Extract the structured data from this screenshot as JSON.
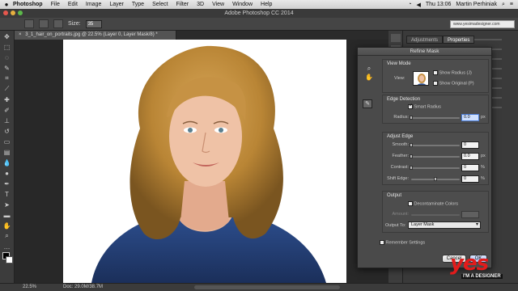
{
  "menubar": {
    "apple_icon": "apple-logo",
    "app_name": "Photoshop",
    "items": [
      "File",
      "Edit",
      "Image",
      "Layer",
      "Type",
      "Select",
      "Filter",
      "3D",
      "View",
      "Window",
      "Help"
    ],
    "clock": "Thu 13:06",
    "user": "Martin Perhiniak"
  },
  "window": {
    "title": "Adobe Photoshop CC 2014"
  },
  "options_bar": {
    "size_label": "Size:",
    "size_value": "35"
  },
  "url_box": "www.yesimadesigner.com",
  "document_tab": {
    "close": "×",
    "title": "3_1_hair_on_portraits.jpg @ 22.5% (Layer 0, Layer Mask/8) *"
  },
  "right_panel": {
    "tabs": [
      "Adjustments",
      "Properties"
    ],
    "active_tab": "Properties"
  },
  "status": {
    "zoom": "22.5%",
    "doc": "Doc: 29.0M/38.7M"
  },
  "dialog": {
    "title": "Refine Mask",
    "view_mode": {
      "title": "View Mode",
      "view_label": "View:",
      "show_radius": "Show Radius (J)",
      "show_original": "Show Original (P)"
    },
    "edge_detection": {
      "title": "Edge Detection",
      "smart_radius": "Smart Radius",
      "radius_label": "Radius:",
      "radius_value": "0.0",
      "radius_unit": "px",
      "radius_level": 0
    },
    "adjust_edge": {
      "title": "Adjust Edge",
      "rows": [
        {
          "label": "Smooth:",
          "value": "0",
          "unit": "",
          "level": 0
        },
        {
          "label": "Feather:",
          "value": "0.0",
          "unit": "px",
          "level": 0
        },
        {
          "label": "Contrast:",
          "value": "0",
          "unit": "%",
          "level": 0
        },
        {
          "label": "Shift Edge:",
          "value": "0",
          "unit": "%",
          "level": 0.5
        }
      ]
    },
    "output": {
      "title": "Output",
      "decontaminate": "Decontaminate Colors",
      "amount_label": "Amount:",
      "output_to_label": "Output To:",
      "output_to_value": "Layer Mask"
    },
    "remember_settings": "Remember Settings",
    "cancel": "Cancel",
    "ok": "OK"
  },
  "logo": {
    "word": "yes",
    "tagline": "I'M A DESIGNER"
  },
  "colors": {
    "logo_red": "#e31b1b",
    "dialog_bg": "#4a4a4a",
    "focus_blue": "#4a7cd6"
  }
}
